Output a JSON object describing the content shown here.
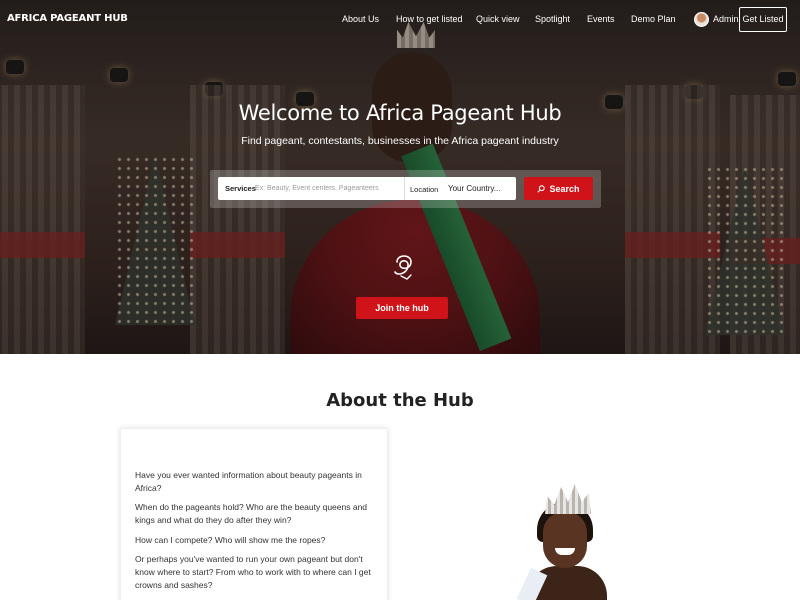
{
  "nav": {
    "brand": "AFRICA PAGEANT HUB",
    "links": [
      {
        "label": "About Us"
      },
      {
        "label": "How to get listed"
      },
      {
        "label": "Quick view"
      },
      {
        "label": "Spotlight"
      },
      {
        "label": "Events"
      },
      {
        "label": "Demo Plan"
      }
    ],
    "user_label": "Admin",
    "cta": "Get Listed"
  },
  "hero": {
    "title": "Welcome to Africa Pageant Hub",
    "subtitle": "Find pageant, contestants, businesses in the Africa pageant industry",
    "search": {
      "services_label": "Services",
      "services_placeholder": "Ex: Beauty, Event centers, Pageanteers",
      "location_label": "Location",
      "location_placeholder": "Your Country...",
      "button_label": "Search"
    },
    "join_button": "Join the hub"
  },
  "about": {
    "title": "About the Hub",
    "paragraphs": [
      "Have you ever wanted information about beauty pageants in Africa?",
      "When do the pageants hold? Who are the beauty queens and kings and what do they do after they win?",
      "How can I compete? Who will show me the ropes?",
      "Or perhaps you've wanted to run your own pageant but don't know where to start? From who to work with to where can I get crowns and sashes?"
    ]
  },
  "colors": {
    "accent": "#d01219",
    "text": "#222222",
    "white": "#ffffff"
  }
}
